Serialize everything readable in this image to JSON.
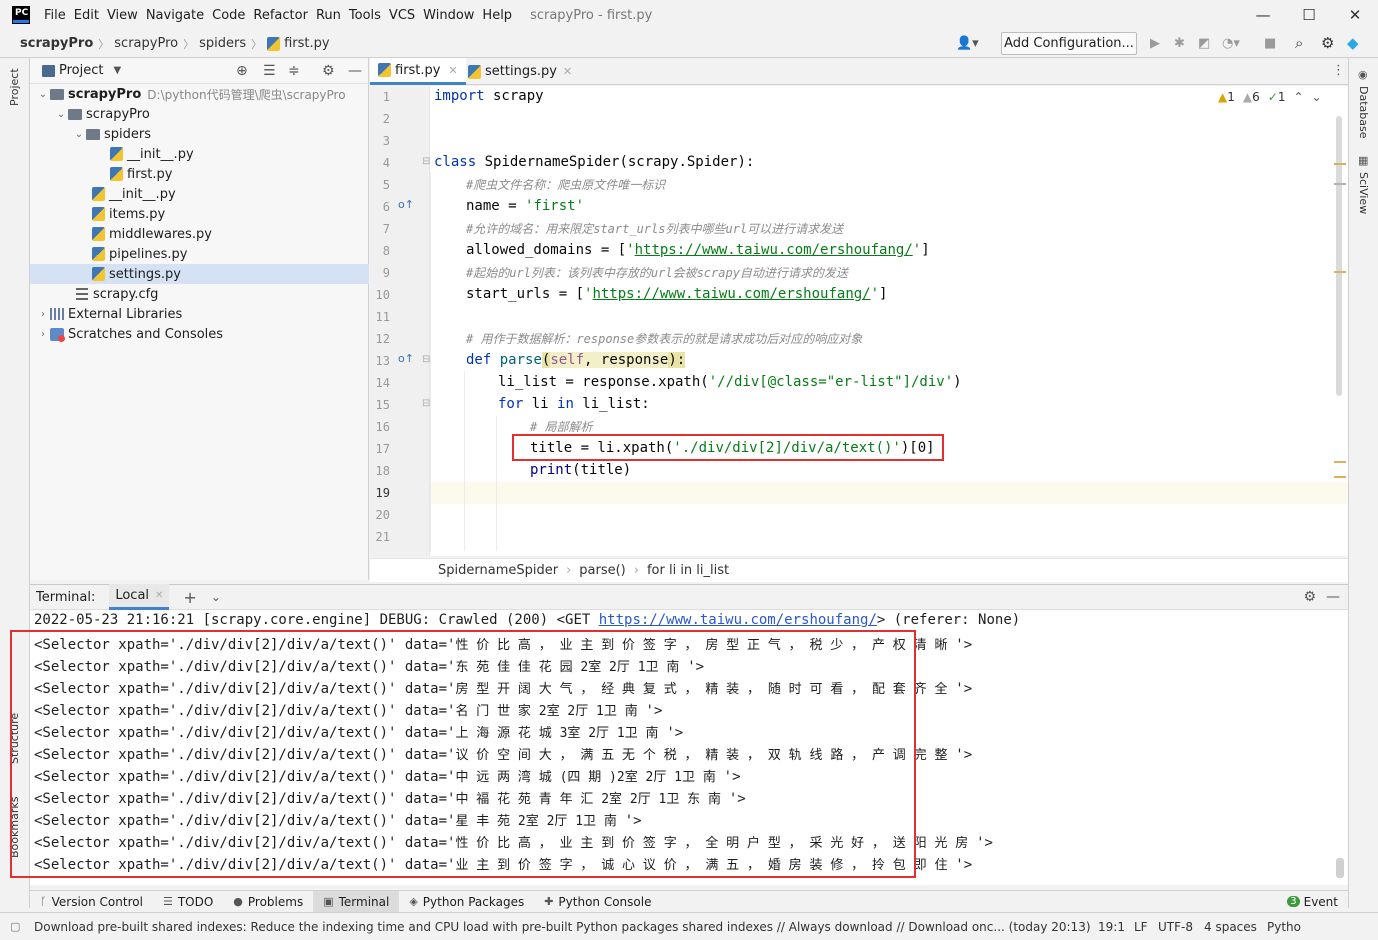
{
  "window": {
    "title": "scrapyPro - first.py",
    "menu": [
      "File",
      "Edit",
      "View",
      "Navigate",
      "Code",
      "Refactor",
      "Run",
      "Tools",
      "VCS",
      "Window",
      "Help"
    ],
    "controls": {
      "minimize": "—",
      "maximize": "☐",
      "close": "✕"
    }
  },
  "navbar": {
    "crumbs": [
      "scrapyPro",
      "scrapyPro",
      "spiders",
      "first.py"
    ],
    "add_config": "Add Configuration..."
  },
  "project": {
    "title": "Project",
    "root_name": "scrapyPro",
    "root_path": "D:\\python代码管理\\爬虫\\scrapyPro",
    "items": [
      {
        "label": "scrapyPro"
      },
      {
        "label": "spiders"
      },
      {
        "label": "__init__.py"
      },
      {
        "label": "first.py"
      },
      {
        "label": "__init__.py"
      },
      {
        "label": "items.py"
      },
      {
        "label": "middlewares.py"
      },
      {
        "label": "pipelines.py"
      },
      {
        "label": "settings.py"
      },
      {
        "label": "scrapy.cfg"
      },
      {
        "label": "External Libraries"
      },
      {
        "label": "Scratches and Consoles"
      }
    ]
  },
  "side_tabs": {
    "project": "Project",
    "structure": "Structure",
    "bookmarks": "Bookmarks",
    "database": "Database",
    "sciview": "SciView"
  },
  "editor": {
    "tabs": [
      "first.py",
      "settings.py"
    ],
    "inspections": {
      "warn1": "1",
      "warn2": "6",
      "ok": "1"
    },
    "line_numbers": [
      "1",
      "2",
      "3",
      "4",
      "5",
      "6",
      "7",
      "8",
      "9",
      "10",
      "11",
      "12",
      "13",
      "14",
      "15",
      "16",
      "17",
      "18",
      "19",
      "20",
      "21"
    ],
    "code": {
      "l1_kw": "import",
      "l1_rest": " scrapy",
      "l4_kw": "class",
      "l4_rest": " SpidernameSpider(scrapy.Spider):",
      "l5": "#爬虫文件名称：爬虫原文件唯一标识",
      "l6_a": "name = ",
      "l6_s": "'first'",
      "l7": "#允许的域名：用来限定start_urls列表中哪些url可以进行请求发送",
      "l8_a": "allowed_domains = [",
      "l8_q1": "'",
      "l8_u": "https://www.taiwu.com/ershoufang/",
      "l8_q2": "'",
      "l8_b": "]",
      "l9": "#起始的url列表：该列表中存放的url会被scrapy自动进行请求的发送",
      "l10_a": "start_urls = [",
      "l10_q1": "'",
      "l10_u": "https://www.taiwu.com/ershoufang/",
      "l10_q2": "'",
      "l10_b": "]",
      "l12": "# 用作于数据解析：response参数表示的就是请求成功后对应的响应对象",
      "l13_kw": "def",
      "l13_fn": " parse",
      "l13_p1": "(",
      "l13_self": "self",
      "l13_c": ", response",
      "l13_p2": "):",
      "l14_a": "li_list = response.xpath(",
      "l14_s": "'//div[@class=\"er-list\"]/div'",
      "l14_b": ")",
      "l15_kw1": "for",
      "l15_m": " li ",
      "l15_kw2": "in",
      "l15_r": " li_list:",
      "l16": "# 局部解析",
      "l17_a": "title = li.xpath(",
      "l17_s": "'./div/div[2]/div/a/text()'",
      "l17_b": ")[0]",
      "l18_kw": "print",
      "l18_r": "(title)"
    },
    "breadcrumbs": [
      "SpidernameSpider",
      "parse()",
      "for li in li_list"
    ]
  },
  "terminal": {
    "label": "Terminal:",
    "tab": "Local",
    "log_prefix": "2022-05-23 21:16:21 [scrapy.core.engine] DEBUG: Crawled (200) <GET ",
    "log_url": "https://www.taiwu.com/ershoufang/",
    "log_suffix": "> (referer: None)",
    "selector_prefix": "<Selector xpath='./div/div[2]/div/a/text()' data='",
    "selector_suffix": "'>",
    "rows": [
      "性 价 比 高 ， 业 主 到 价 签 字 ， 房 型 正 气 ， 税 少 ， 产 权 清 晰 ",
      "东 苑 佳 佳 花 园 2室 2厅 1卫 南 ",
      "房 型 开 阔 大 气 ， 经 典 复 式 ， 精 装 ， 随 时 可 看 ， 配 套 齐 全 ",
      "名 门 世 家 2室 2厅 1卫 南 ",
      "上 海 源 花 城 3室 2厅 1卫 南 ",
      "议 价 空 间 大 ， 满 五 无 个 税 ， 精 装 ， 双 轨 线 路 ， 产 调 完 整 ",
      "中 远 两 湾 城 (四 期 )2室 2厅 1卫 南 ",
      "中 福 花 苑 青 年 汇 2室 2厅 1卫 东 南 ",
      "星 丰 苑 2室 2厅 1卫 南 ",
      "性 价 比 高 ， 业 主 到 价 签 字 ， 全 明 户 型 ， 采 光 好 ， 送 阳 光 房 ",
      "业 主 到 价 签 字 ， 诚 心 议 价 ， 满 五 ， 婚 房 装 修 ， 拎 包 即 住 "
    ]
  },
  "toolwindows": [
    "Version Control",
    "TODO",
    "Problems",
    "Terminal",
    "Python Packages",
    "Python Console"
  ],
  "status": {
    "message": "Download pre-built shared indexes: Reduce the indexing time and CPU load with pre-built Python packages shared indexes // Always download // Download onc... (today 20:13)",
    "position": "19:1",
    "line_sep": "LF",
    "encoding": "UTF-8",
    "indent": "4 spaces",
    "interpreter": "Pytho",
    "event_count": "3",
    "event_label": "Event"
  }
}
